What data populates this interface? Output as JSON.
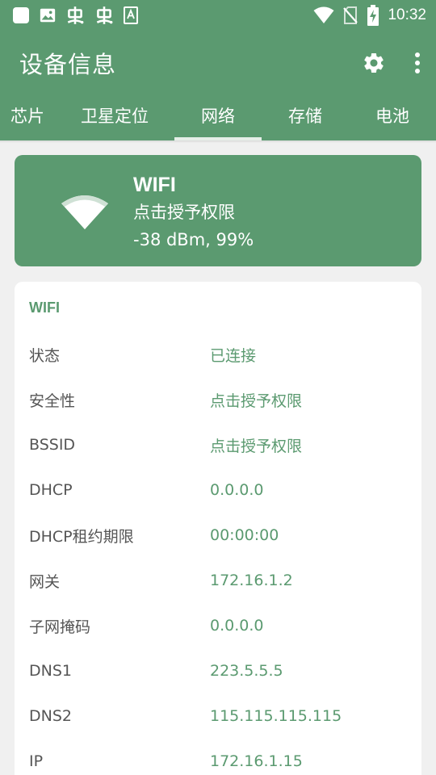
{
  "status_bar": {
    "time": "10:32",
    "left_icons": [
      "square-app-icon",
      "image-icon",
      "bug-icon",
      "bug-icon",
      "font-icon"
    ],
    "right_icons": [
      "wifi-icon",
      "no-sim-icon",
      "battery-charging-icon"
    ]
  },
  "app_bar": {
    "title": "设备信息",
    "actions": [
      "gear-icon",
      "more-vert-icon"
    ]
  },
  "tabs": [
    {
      "label": "芯片",
      "active": false
    },
    {
      "label": "卫星定位",
      "active": false
    },
    {
      "label": "网络",
      "active": true
    },
    {
      "label": "存储",
      "active": false
    },
    {
      "label": "电池",
      "active": false
    }
  ],
  "hero": {
    "icon": "wifi-signal-icon",
    "title": "WIFI",
    "subtitle": "点击授予权限",
    "signal": "-38 dBm, 99%"
  },
  "details": {
    "title": "WIFI",
    "rows": [
      {
        "label": "状态",
        "value": "已连接"
      },
      {
        "label": "安全性",
        "value": "点击授予权限"
      },
      {
        "label": "BSSID",
        "value": "点击授予权限"
      },
      {
        "label": "DHCP",
        "value": "0.0.0.0"
      },
      {
        "label": "DHCP租约期限",
        "value": "00:00:00"
      },
      {
        "label": "网关",
        "value": "172.16.1.2"
      },
      {
        "label": "子网掩码",
        "value": "0.0.0.0"
      },
      {
        "label": "DNS1",
        "value": "223.5.5.5"
      },
      {
        "label": "DNS2",
        "value": "115.115.115.115"
      },
      {
        "label": "IP",
        "value": "172.16.1.15"
      }
    ]
  },
  "colors": {
    "primary": "#5b9a70",
    "background": "#f0f0f0",
    "card": "#ffffff",
    "label_text": "#555555"
  }
}
